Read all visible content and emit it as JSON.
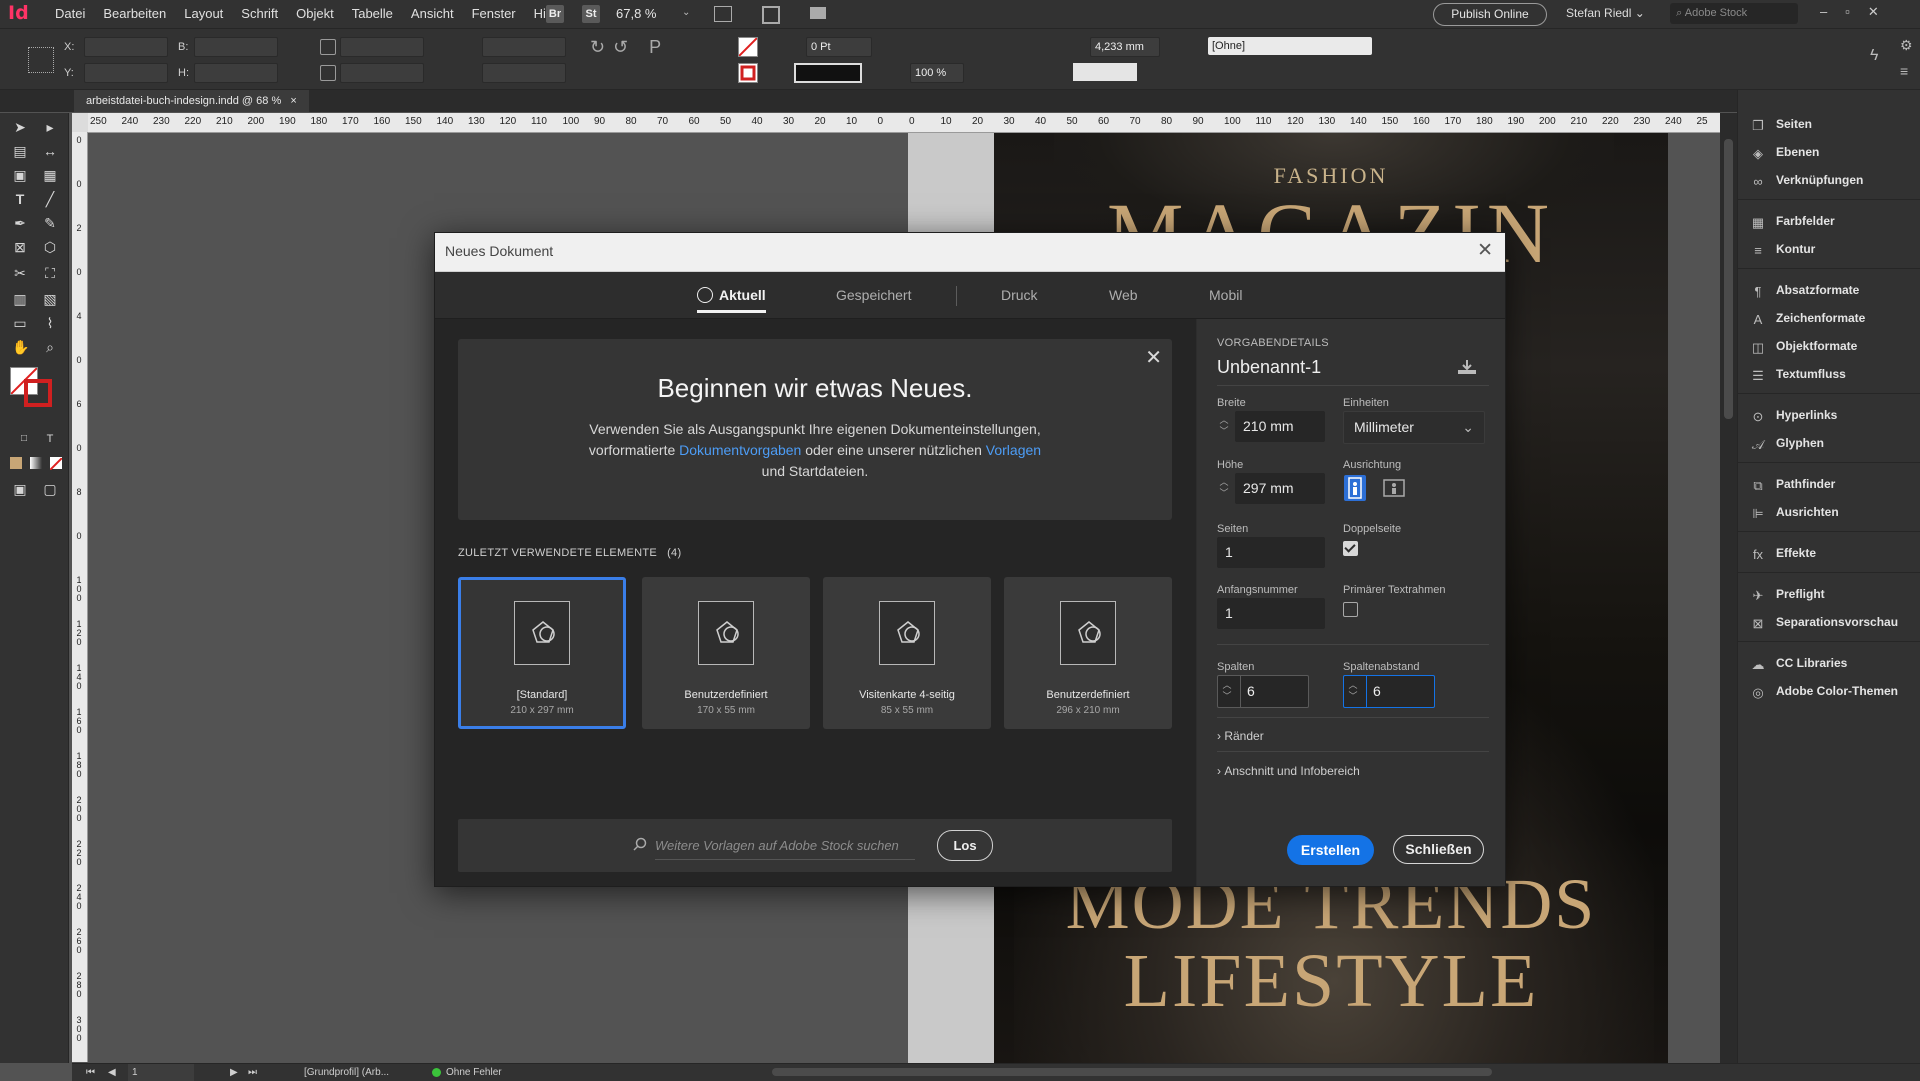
{
  "app": {
    "logo": "Id",
    "menu": [
      "Datei",
      "Bearbeiten",
      "Layout",
      "Schrift",
      "Objekt",
      "Tabelle",
      "Ansicht",
      "Fenster",
      "Hilfe"
    ],
    "bridge_badge": "Br",
    "stock_badge": "St",
    "zoom": "67,8 %",
    "publish_label": "Publish Online",
    "user_name": "Stefan Riedl",
    "stock_search_placeholder": "Adobe Stock"
  },
  "control_bar": {
    "x_label": "X:",
    "y_label": "Y:",
    "w_label": "B:",
    "h_label": "H:",
    "stroke_weight": "0 Pt",
    "scale_pct": "100 %",
    "offset_value": "4,233 mm",
    "object_style": "[Ohne]"
  },
  "document_tab": {
    "label": "arbeistdatei-buch-indesign.indd @ 68 %",
    "close": "×"
  },
  "ruler": {
    "h_ticks": [
      "250",
      "240",
      "230",
      "220",
      "210",
      "200",
      "190",
      "180",
      "170",
      "160",
      "150",
      "140",
      "130",
      "120",
      "110",
      "100",
      "90",
      "80",
      "70",
      "60",
      "50",
      "40",
      "30",
      "20",
      "10",
      "0",
      "0",
      "10",
      "20",
      "30",
      "40",
      "50",
      "60",
      "70",
      "80",
      "90",
      "100",
      "110",
      "120",
      "130",
      "140",
      "150",
      "160",
      "170",
      "180",
      "190",
      "200",
      "210",
      "220",
      "230",
      "240",
      "25"
    ],
    "v_ticks": [
      "0",
      "0",
      "2",
      "0",
      "4",
      "0",
      "6",
      "0",
      "8",
      "0",
      "1 0 0",
      "1 2 0",
      "1 4 0",
      "1 6 0",
      "1 8 0",
      "2 0 0",
      "2 2 0",
      "2 4 0",
      "2 6 0",
      "2 8 0",
      "3 0 0"
    ]
  },
  "magazine": {
    "fashion": "FASHION",
    "title": "MAGAZIN",
    "mode": "MODE TRENDS",
    "lifestyle": "LIFESTYLE"
  },
  "panels": {
    "items": [
      "Seiten",
      "Ebenen",
      "Verknüpfungen",
      "Farbfelder",
      "Kontur",
      "Absatzformate",
      "Zeichenformate",
      "Objektformate",
      "Textumfluss",
      "Hyperlinks",
      "Glyphen",
      "Pathfinder",
      "Ausrichten",
      "Effekte",
      "Preflight",
      "Separationsvorschau",
      "CC Libraries",
      "Adobe Color-Themen"
    ]
  },
  "statusbar": {
    "page": "1",
    "profile": "[Grundprofil] (Arb...",
    "preflight": "Ohne Fehler"
  },
  "dialog": {
    "title": "Neues Dokument",
    "close": "✕",
    "tabs": {
      "aktuell": "Aktuell",
      "gespeichert": "Gespeichert",
      "druck": "Druck",
      "web": "Web",
      "mobil": "Mobil"
    },
    "welcome": {
      "heading": "Beginnen wir etwas Neues.",
      "line1": "Verwenden Sie als Ausgangspunkt Ihre eigenen Dokumenteinstellungen,",
      "line2_pre": "vorformatierte ",
      "line2_link1": "Dokumentvorgaben",
      "line2_mid": " oder eine unserer nützlichen ",
      "line2_link2": "Vorlagen",
      "line3": "und Startdateien.",
      "close": "✕"
    },
    "recent": {
      "heading": "ZULETZT VERWENDETE ELEMENTE",
      "count": "(4)",
      "items": [
        {
          "name": "[Standard]",
          "dims": "210 x 297 mm"
        },
        {
          "name": "Benutzerdefiniert",
          "dims": "170 x 55 mm"
        },
        {
          "name": "Visitenkarte 4-seitig",
          "dims": "85 x 55 mm"
        },
        {
          "name": "Benutzerdefiniert",
          "dims": "296 x 210 mm"
        }
      ]
    },
    "search": {
      "placeholder": "Weitere Vorlagen auf Adobe Stock suchen",
      "go": "Los"
    },
    "preset": {
      "section": "VORGABENDETAILS",
      "name": "Unbenannt-1",
      "width_label": "Breite",
      "width": "210 mm",
      "units_label": "Einheiten",
      "units": "Millimeter",
      "height_label": "Höhe",
      "height": "297 mm",
      "orientation_label": "Ausrichtung",
      "pages_label": "Seiten",
      "pages": "1",
      "facing_label": "Doppelseite",
      "facing": true,
      "start_label": "Anfangsnummer",
      "start": "1",
      "primary_label": "Primärer Textrahmen",
      "primary": false,
      "columns_label": "Spalten",
      "columns": "6",
      "gutter_label": "Spaltenabstand",
      "gutter": "6",
      "margins": "Ränder",
      "bleed": "Anschnitt und Infobereich"
    },
    "buttons": {
      "create": "Erstellen",
      "close": "Schließen"
    }
  }
}
